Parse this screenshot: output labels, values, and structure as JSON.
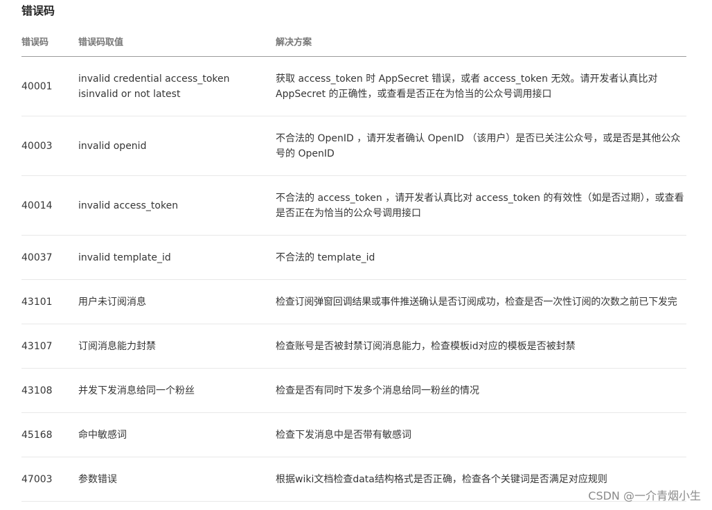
{
  "title": "错误码",
  "headers": [
    "错误码",
    "错误码取值",
    "解决方案"
  ],
  "rows": [
    {
      "code": "40001",
      "value": "invalid credential  access_token isinvalid or not latest",
      "solution": "获取 access_token 时 AppSecret 错误，或者 access_token 无效。请开发者认真比对 AppSecret 的正确性，或查看是否正在为恰当的公众号调用接口"
    },
    {
      "code": "40003",
      "value": "invalid openid",
      "solution": "不合法的 OpenID ，请开发者确认 OpenID （该用户）是否已关注公众号，或是否是其他公众号的 OpenID"
    },
    {
      "code": "40014",
      "value": "invalid access_token",
      "solution": "不合法的 access_token ，请开发者认真比对 access_token 的有效性（如是否过期），或查看是否正在为恰当的公众号调用接口"
    },
    {
      "code": "40037",
      "value": "invalid template_id",
      "solution": "不合法的 template_id"
    },
    {
      "code": "43101",
      "value": "用户未订阅消息",
      "solution": "检查订阅弹窗回调结果或事件推送确认是否订阅成功，检查是否一次性订阅的次数之前已下发完"
    },
    {
      "code": "43107",
      "value": "订阅消息能力封禁",
      "solution": "检查账号是否被封禁订阅消息能力，检查模板id对应的模板是否被封禁"
    },
    {
      "code": "43108",
      "value": "并发下发消息给同一个粉丝",
      "solution": "检查是否有同时下发多个消息给同一粉丝的情况"
    },
    {
      "code": "45168",
      "value": "命中敏感词",
      "solution": "检查下发消息中是否带有敏感词"
    },
    {
      "code": "47003",
      "value": "参数错误",
      "solution": "根据wiki文档检查data结构格式是否正确，检查各个关键词是否满足对应规则"
    }
  ],
  "watermark": "CSDN @一介青烟小生"
}
